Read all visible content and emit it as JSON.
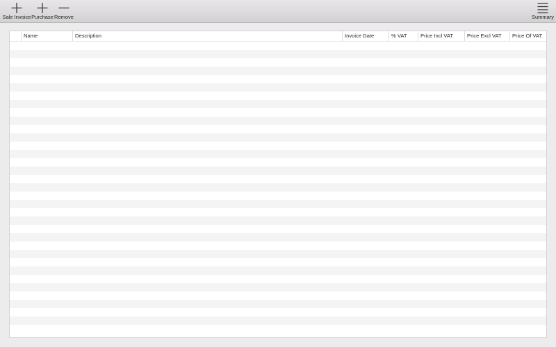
{
  "toolbar": {
    "sale_invoice_label": "Sale Invoice",
    "purchase_label": "Purchase",
    "remove_label": "Remove",
    "summary_label": "Summary",
    "icons": {
      "sale_invoice": "plus-icon",
      "purchase": "plus-icon",
      "remove": "minus-icon",
      "summary": "list-icon"
    }
  },
  "table": {
    "columns": [
      "",
      "Name",
      "Description",
      "Invoice Date",
      "% VAT",
      "Price Incl VAT",
      "Price Excl VAT",
      "Price Of VAT"
    ],
    "rows": []
  },
  "colors": {
    "row_alt": "#f4f4f4",
    "row_base": "#ffffff",
    "toolbar_top": "#e8e6e8",
    "toolbar_bottom": "#d3d1d3",
    "text": "#2a2a2a"
  }
}
